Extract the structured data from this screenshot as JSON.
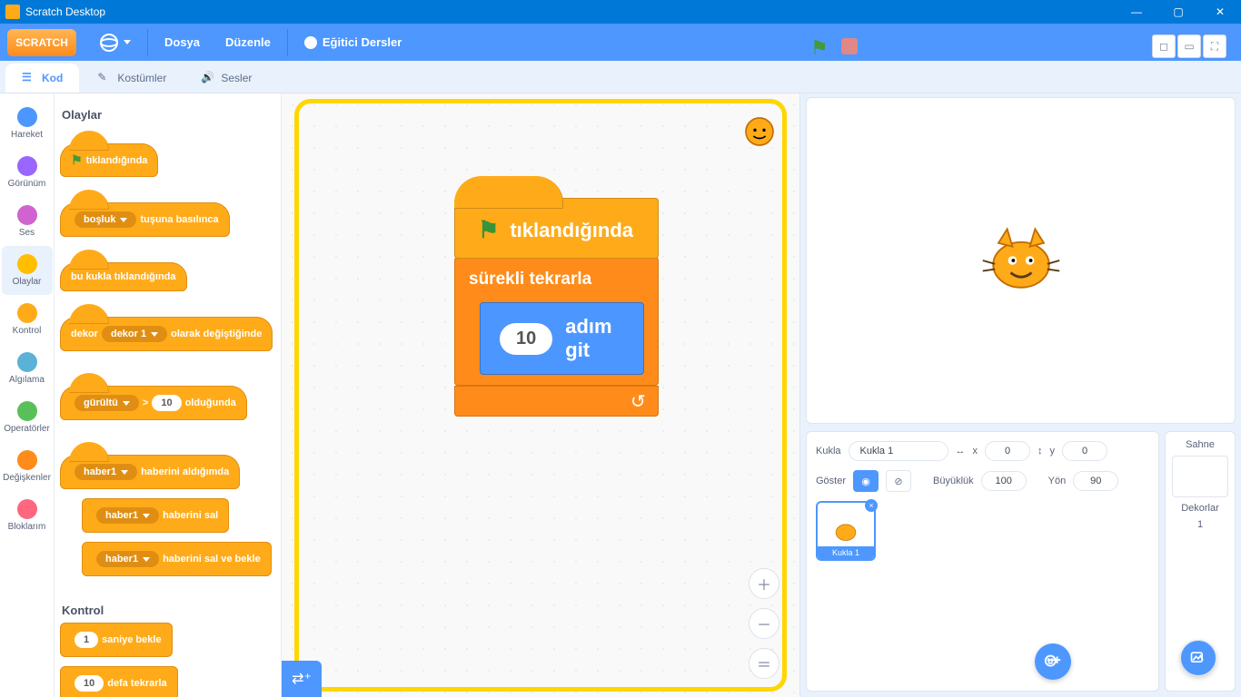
{
  "window": {
    "title": "Scratch Desktop"
  },
  "menu": {
    "logo": "SCRATCH",
    "file": "Dosya",
    "edit": "Düzenle",
    "tutorials": "Eğitici Dersler"
  },
  "tabs": {
    "code": "Kod",
    "costumes": "Kostümler",
    "sounds": "Sesler"
  },
  "categories": [
    {
      "name": "Hareket",
      "color": "#4c97ff"
    },
    {
      "name": "Görünüm",
      "color": "#9966ff"
    },
    {
      "name": "Ses",
      "color": "#cf63cf"
    },
    {
      "name": "Olaylar",
      "color": "#ffbf00",
      "selected": true
    },
    {
      "name": "Kontrol",
      "color": "#ffab19"
    },
    {
      "name": "Algılama",
      "color": "#5cb1d6"
    },
    {
      "name": "Operatörler",
      "color": "#59c059"
    },
    {
      "name": "Değişkenler",
      "color": "#ff8c1a"
    },
    {
      "name": "Bloklarım",
      "color": "#ff6680"
    }
  ],
  "palette": {
    "events_header": "Olaylar",
    "when_flag": "tıklandığında",
    "when_key_pre": "boşluk",
    "when_key_post": "tuşuna basılınca",
    "when_sprite_clicked": "bu kukla tıklandığında",
    "backdrop_pre": "dekor",
    "backdrop_dd": "dekor 1",
    "backdrop_post": "olarak değiştiğinde",
    "loudness_dd": "gürültü",
    "loudness_gt": ">",
    "loudness_val": "10",
    "loudness_post": "olduğunda",
    "receive_dd": "haber1",
    "receive_post": "haberini aldığımda",
    "broadcast_dd": "haber1",
    "broadcast_post": "haberini sal",
    "broadcast_wait_dd": "haber1",
    "broadcast_wait_post": "haberini sal ve bekle",
    "control_header": "Kontrol",
    "wait_val": "1",
    "wait_post": "saniye bekle",
    "repeat_val": "10",
    "repeat_post": "defa tekrarla"
  },
  "script": {
    "hat": "tıklandığında",
    "forever": "sürekli tekrarla",
    "move_val": "10",
    "move_post": "adım git"
  },
  "sprite_info": {
    "sprite_label": "Kukla",
    "sprite_name": "Kukla 1",
    "x_label": "x",
    "x_val": "0",
    "y_label": "y",
    "y_val": "0",
    "show_label": "Göster",
    "size_label": "Büyüklük",
    "size_val": "100",
    "dir_label": "Yön",
    "dir_val": "90",
    "tile_label": "Kukla 1"
  },
  "stage_pane": {
    "title": "Sahne",
    "backdrops_label": "Dekorlar",
    "backdrops_count": "1"
  }
}
